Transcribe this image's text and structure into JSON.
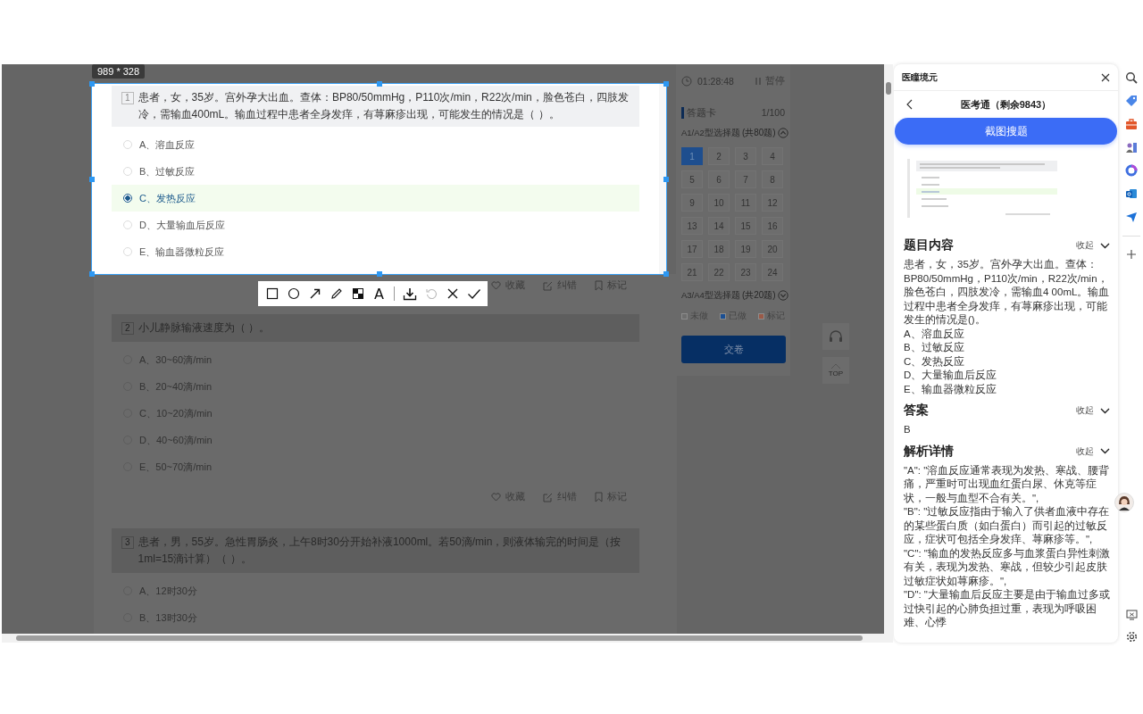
{
  "capture": {
    "size_label": "989 * 328",
    "tools": [
      {
        "kind": "rectangle",
        "disabled": false
      },
      {
        "kind": "ellipse",
        "disabled": false
      },
      {
        "kind": "arrow",
        "disabled": false
      },
      {
        "kind": "pen",
        "disabled": false
      },
      {
        "kind": "mosaic",
        "disabled": false
      },
      {
        "kind": "text",
        "label": "A",
        "disabled": false
      },
      {
        "kind": "save",
        "disabled": false
      },
      {
        "kind": "undo",
        "disabled": true
      },
      {
        "kind": "cancel",
        "disabled": false
      },
      {
        "kind": "confirm",
        "disabled": false
      }
    ]
  },
  "questions": [
    {
      "number": "1",
      "text": "患者，女，35岁。宫外孕大出血。查体：BP80/50mmHg，P110次/min，R22次/min，脸色苍白，四肢发冷，需输血400mL。输血过程中患者全身发痒，有荨麻疹出现，可能发生的情况是（ ）。",
      "options": [
        {
          "label": "A、溶血反应",
          "selected": false
        },
        {
          "label": "B、过敏反应",
          "selected": false
        },
        {
          "label": "C、发热反应",
          "selected": true
        },
        {
          "label": "D、大量输血后反应",
          "selected": false
        },
        {
          "label": "E、输血器微粒反应",
          "selected": false
        }
      ],
      "actions": [
        "收藏",
        "纠错",
        "标记"
      ]
    },
    {
      "number": "2",
      "text": "小儿静脉输液速度为（ ）。",
      "options": [
        {
          "label": "A、30~60滴/min",
          "selected": false
        },
        {
          "label": "B、20~40滴/min",
          "selected": false
        },
        {
          "label": "C、10~20滴/min",
          "selected": false
        },
        {
          "label": "D、40~60滴/min",
          "selected": false
        },
        {
          "label": "E、50~70滴/min",
          "selected": false
        }
      ],
      "actions": [
        "收藏",
        "纠错",
        "标记"
      ]
    },
    {
      "number": "3",
      "text": "患者，男，55岁。急性胃肠炎，上午8时30分开始补液1000ml。若50滴/min，则液体输完的时间是（按1ml=15滴计算）（ ）。",
      "options": [
        {
          "label": "A、12时30分",
          "selected": false
        },
        {
          "label": "B、13时30分",
          "selected": false
        }
      ]
    }
  ],
  "timer": {
    "time": "01:28:48",
    "pause": "暂停"
  },
  "answer_card": {
    "title": "答题卡",
    "progress": "1/100",
    "sections": [
      {
        "title": "A1/A2型选择题",
        "count": "(共80题)",
        "expanded": true,
        "numbers": [
          {
            "label": "1",
            "selected": true
          },
          {
            "label": "2",
            "selected": false
          },
          {
            "label": "3",
            "selected": false
          },
          {
            "label": "4",
            "selected": false
          },
          {
            "label": "5",
            "selected": false
          },
          {
            "label": "6",
            "selected": false
          },
          {
            "label": "7",
            "selected": false
          },
          {
            "label": "8",
            "selected": false
          },
          {
            "label": "9",
            "selected": false
          },
          {
            "label": "10",
            "selected": false
          },
          {
            "label": "11",
            "selected": false
          },
          {
            "label": "12",
            "selected": false
          },
          {
            "label": "13",
            "selected": false
          },
          {
            "label": "14",
            "selected": false
          },
          {
            "label": "15",
            "selected": false
          },
          {
            "label": "16",
            "selected": false
          },
          {
            "label": "17",
            "selected": false
          },
          {
            "label": "18",
            "selected": false
          },
          {
            "label": "19",
            "selected": false
          },
          {
            "label": "20",
            "selected": false
          },
          {
            "label": "21",
            "selected": false
          },
          {
            "label": "22",
            "selected": false
          },
          {
            "label": "23",
            "selected": false
          },
          {
            "label": "24",
            "selected": false
          }
        ]
      },
      {
        "title": "A3/A4型选择题",
        "count": "(共20题)",
        "expanded": false
      }
    ],
    "legend": [
      {
        "label": "未做",
        "color": "#6e6e6e"
      },
      {
        "label": "已做",
        "color": "#1b4f93"
      },
      {
        "label": "标记",
        "color": "#9a5a48"
      }
    ],
    "submit": "交卷"
  },
  "float_top": "TOP",
  "panel": {
    "title": "医瞳境元",
    "subtitle": "医考通（剩余9843）",
    "search_button": "截图搜题",
    "sections": [
      {
        "heading": "题目内容",
        "toggle": "收起",
        "expanded": true,
        "lines": [
          "患者，女，35岁。宫外孕大出血。查体：BP80/50mmHg，P110次/min，R22次/min，脸色苍白，四肢发冷，需输血4 00mL。输血过程中患者全身发痒，有荨麻疹出现，可能发生的情况是()。",
          "A、溶血反应",
          "B、过敏反应",
          "C、发热反应",
          "D、大量输血后反应",
          "E、输血器微粒反应"
        ]
      },
      {
        "heading": "答案",
        "toggle": "收起",
        "expanded": true,
        "lines": [
          "B"
        ]
      },
      {
        "heading": "解析详情",
        "toggle": "收起",
        "expanded": true,
        "lines": [
          "\"A\": \"溶血反应通常表现为发热、寒战、腰背痛，严重时可出现血红蛋白尿、休克等症状，一般与血型不合有关。\",",
          "\"B\": \"过敏反应指由于输入了供者血液中存在的某些蛋白质（如白蛋白）而引起的过敏反应，症状可包括全身发痒、荨麻疹等。\",",
          "\"C\": \"输血的发热反应多与血浆蛋白异性刺激有关，表现为发热、寒战，但较少引起皮肤过敏症状如荨麻疹。\",",
          "\"D\": \"大量输血后反应主要是由于输血过多或过快引起的心肺负担过重，表现为呼吸困难、心悸"
        ]
      }
    ]
  }
}
